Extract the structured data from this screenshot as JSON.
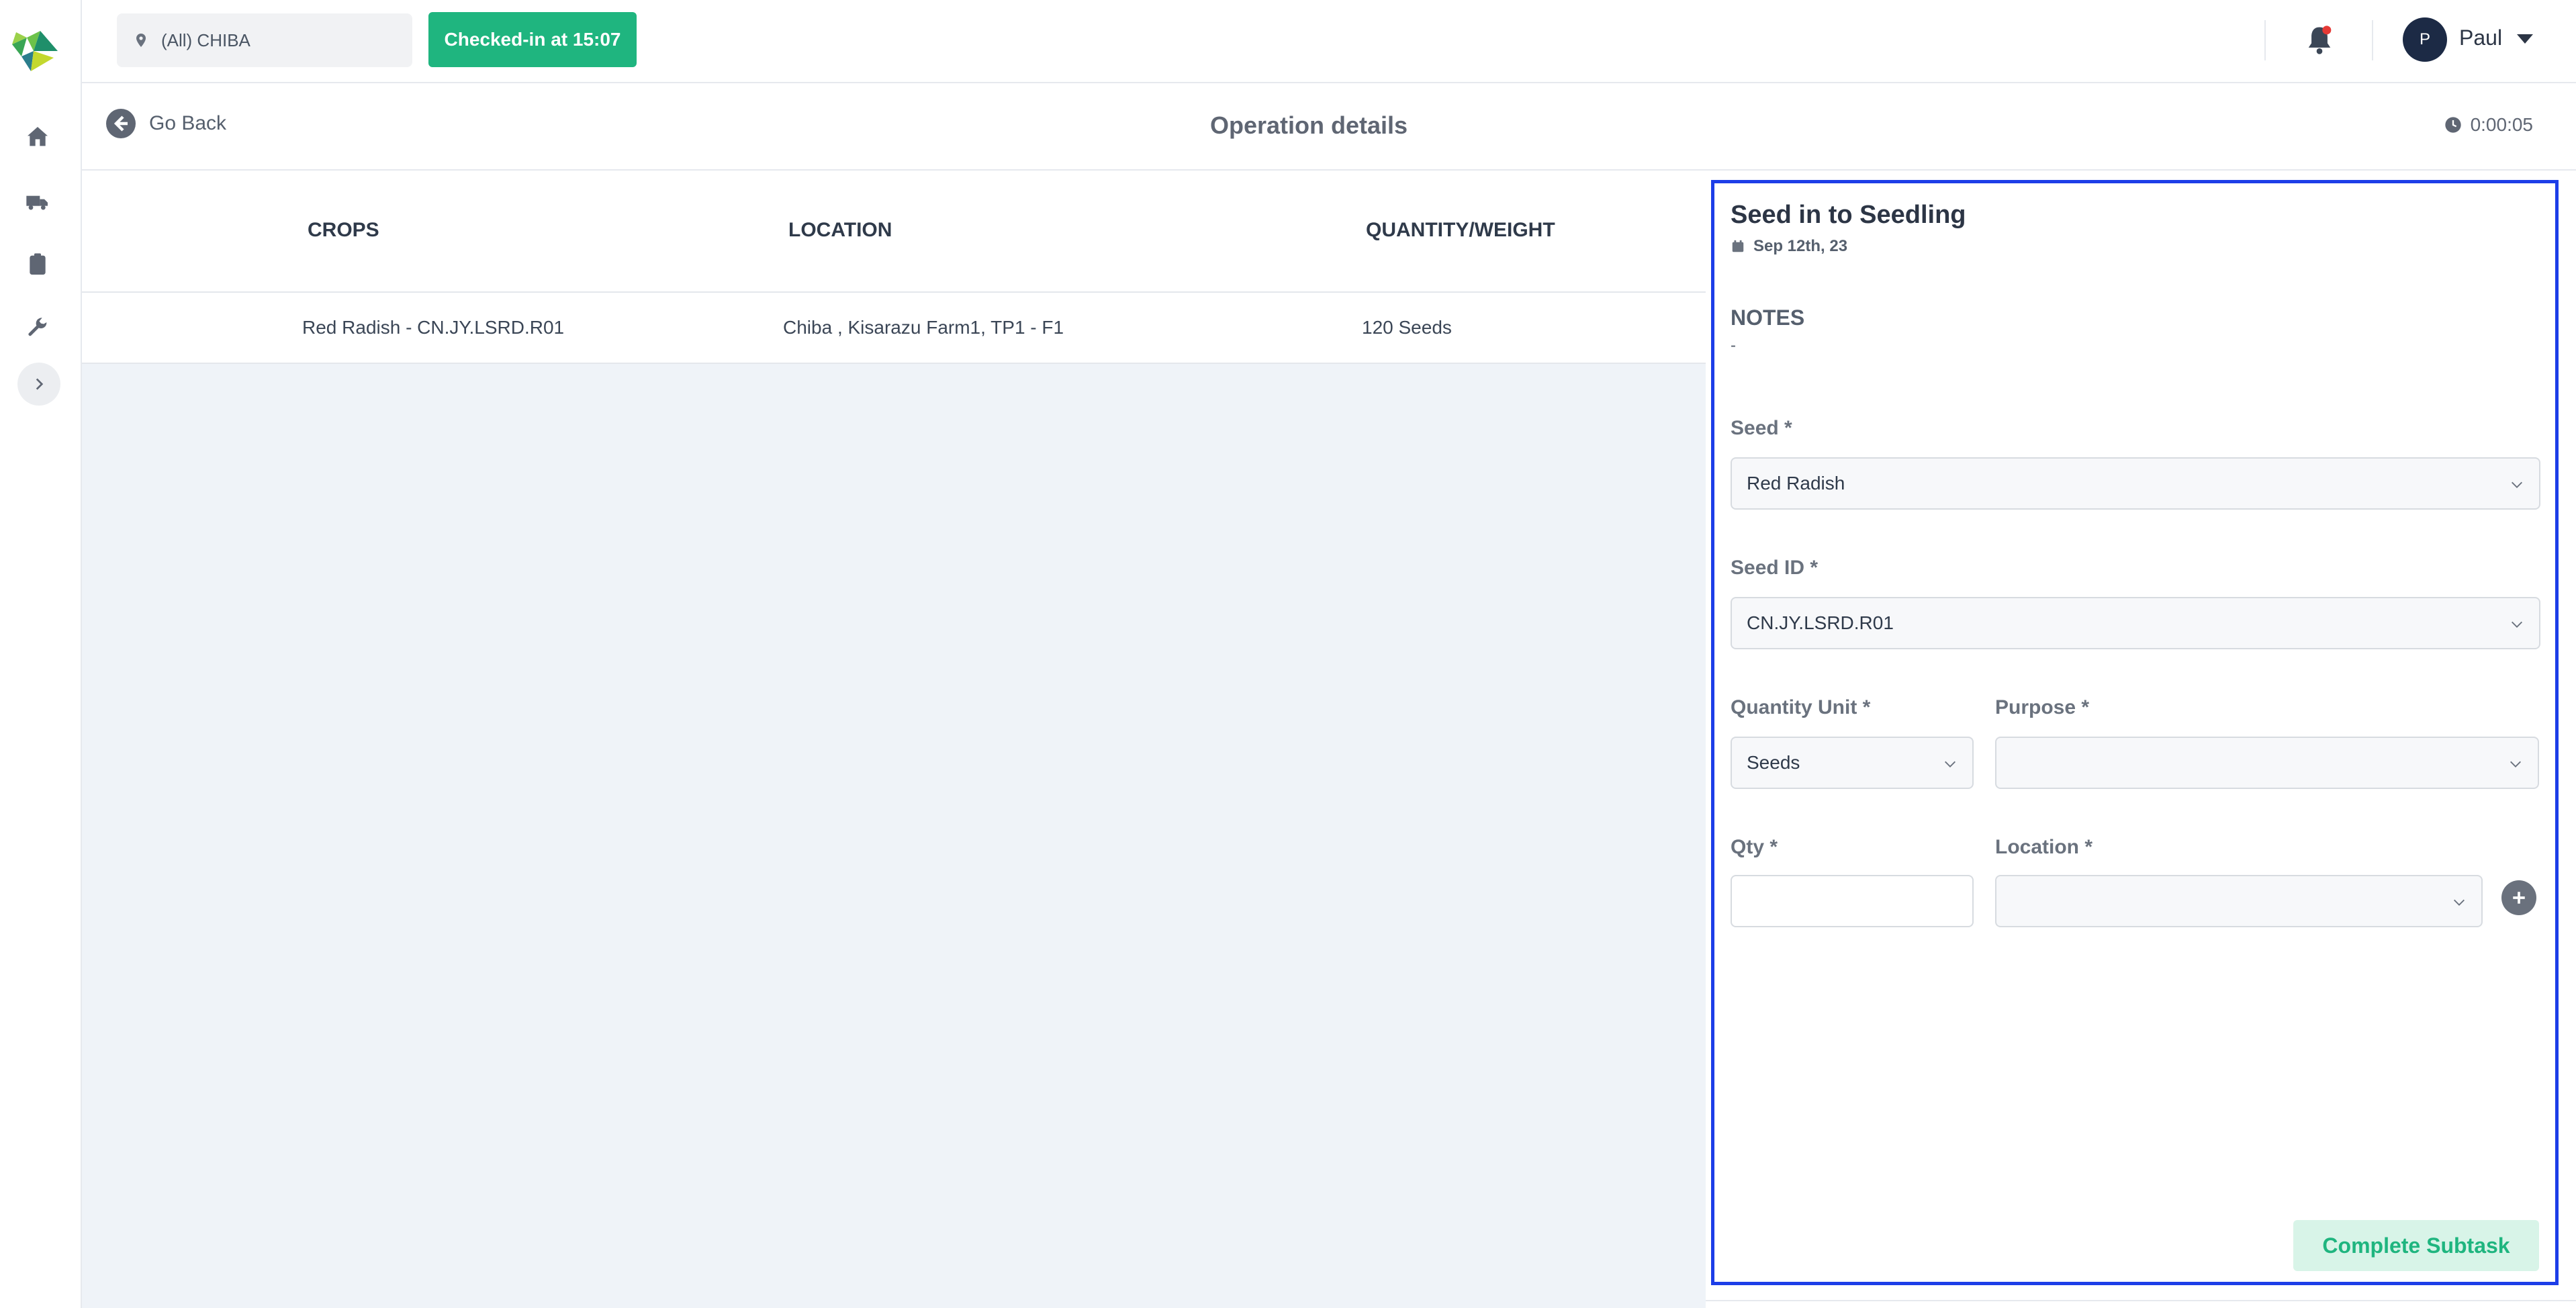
{
  "header": {
    "location_label": "(All) CHIBA",
    "checkin_label": "Checked-in at 15:07",
    "user_initial": "P",
    "user_name": "Paul"
  },
  "subheader": {
    "back_label": "Go Back",
    "title": "Operation details",
    "timer": "0:00:05"
  },
  "table": {
    "columns": [
      "CROPS",
      "LOCATION",
      "QUANTITY/WEIGHT"
    ],
    "rows": [
      [
        "Red Radish - CN.JY.LSRD.R01",
        "Chiba , Kisarazu Farm1, TP1 - F1",
        "120 Seeds"
      ]
    ]
  },
  "panel": {
    "title": "Seed in to Seedling",
    "date": "Sep 12th, 23",
    "notes_label": "NOTES",
    "notes_value": "-",
    "seed_label": "Seed *",
    "seed_value": "Red Radish",
    "seed_id_label": "Seed ID *",
    "seed_id_value": "CN.JY.LSRD.R01",
    "quantity_unit_label": "Quantity Unit *",
    "quantity_unit_value": "Seeds",
    "purpose_label": "Purpose *",
    "purpose_value": "",
    "qty_label": "Qty *",
    "qty_value": "",
    "location_label": "Location *",
    "location_value": "",
    "complete_label": "Complete Subtask"
  },
  "colors": {
    "accent_green": "#1fb57f",
    "highlight_border": "#1d3ee8",
    "notification_dot": "#e53935"
  }
}
